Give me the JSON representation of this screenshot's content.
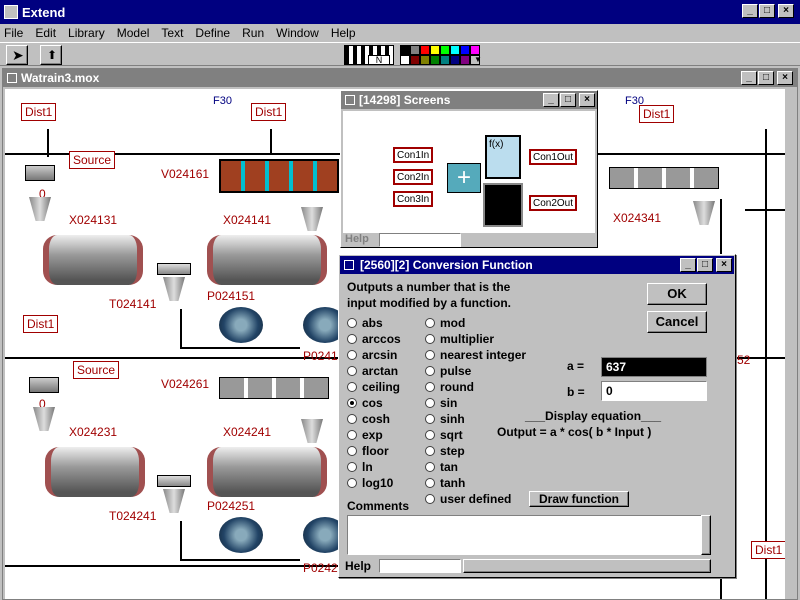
{
  "app": {
    "title": "Extend",
    "menu": [
      "File",
      "Edit",
      "Library",
      "Model",
      "Text",
      "Define",
      "Run",
      "Window",
      "Help"
    ]
  },
  "colors": {
    "titlebar": "#000080",
    "label_red": "#a00000",
    "palette": [
      "#000000",
      "#808080",
      "#ff0000",
      "#ffff00",
      "#00ff00",
      "#00ffff",
      "#0000ff",
      "#ff00ff",
      "#ffffff",
      "#800000",
      "#808000",
      "#008000",
      "#008080",
      "#000080",
      "#800080",
      "#c0c0c0"
    ]
  },
  "toolbar": {
    "pattern_label": "N"
  },
  "model_window": {
    "title": "Watrain3.mox",
    "labels": {
      "dist1_a": "Dist1",
      "dist1_b": "Dist1",
      "dist1_c": "Dist1",
      "dist1_d": "Dist1",
      "dist1_e": "Dist1",
      "dist1_f": "Dist1",
      "f30_a": "F30",
      "f30_b": "F30",
      "source_a": "Source",
      "source_b": "Source",
      "v1": "V024161",
      "v2": "V024261",
      "x1": "X024131",
      "x2": "X024141",
      "x3": "X024231",
      "x4": "X024241",
      "x5": "X024341",
      "t1": "T024141",
      "t2": "T024241",
      "p1": "P024151",
      "p2": "P024251",
      "p3": "P0241",
      "p4": "P0242",
      "n52": "52",
      "zero_a": "0",
      "zero_b": "0"
    }
  },
  "screens_window": {
    "title": "[14298]   Screens",
    "help": "Help",
    "con1in": "Con1In",
    "con2in": "Con2In",
    "con3in": "Con3In",
    "con1out": "Con1Out",
    "con2out": "Con2Out",
    "fx": "f(x)"
  },
  "dialog": {
    "title": "[2560][2]   Conversion Function",
    "description_line1": "Outputs a number that is the",
    "description_line2": "input modified by a function.",
    "ok": "OK",
    "cancel": "Cancel",
    "functions_col1": [
      "abs",
      "arccos",
      "arcsin",
      "arctan",
      "ceiling",
      "cos",
      "cosh",
      "exp",
      "floor",
      "ln",
      "log10"
    ],
    "functions_col2": [
      "mod",
      "multiplier",
      "nearest integer",
      "pulse",
      "round",
      "sin",
      "sinh",
      "sqrt",
      "step",
      "tan",
      "tanh",
      "user defined"
    ],
    "selected": "cos",
    "a_label": "a =",
    "a_value": "637",
    "b_label": "b =",
    "b_value": "0",
    "display_equation": "___Display equation___",
    "output_equation": "Output = a * cos( b * Input )",
    "draw_function": "Draw function",
    "comments_label": "Comments",
    "help": "Help"
  }
}
